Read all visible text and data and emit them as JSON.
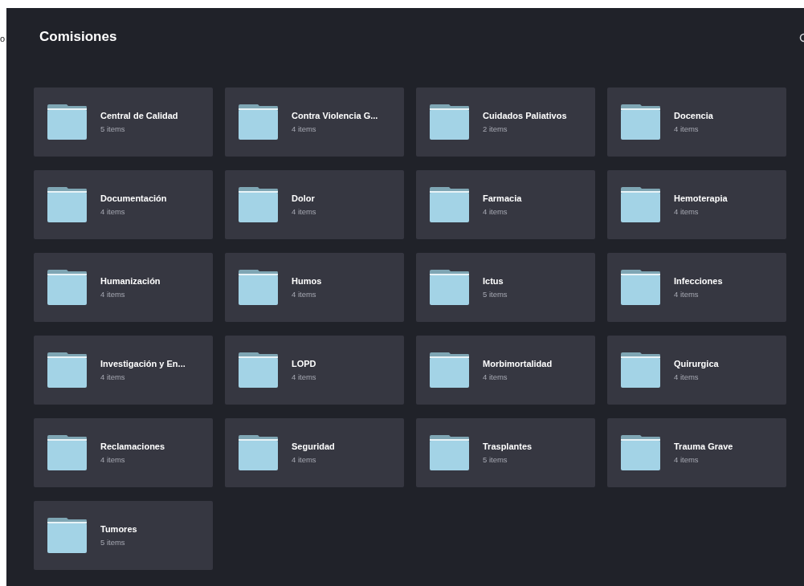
{
  "page_fragment": "o",
  "title": "Comisiones",
  "folders": [
    {
      "name": "Central de Calidad",
      "count": "5 items"
    },
    {
      "name": "Contra Violencia G...",
      "count": "4 items"
    },
    {
      "name": "Cuidados Paliativos",
      "count": "2 items"
    },
    {
      "name": "Docencia",
      "count": "4 items"
    },
    {
      "name": "Documentación",
      "count": "4 items"
    },
    {
      "name": "Dolor",
      "count": "4 items"
    },
    {
      "name": "Farmacia",
      "count": "4 items"
    },
    {
      "name": "Hemoterapia",
      "count": "4 items"
    },
    {
      "name": "Humanización",
      "count": "4 items"
    },
    {
      "name": "Humos",
      "count": "4 items"
    },
    {
      "name": "Ictus",
      "count": "5 items"
    },
    {
      "name": "Infecciones",
      "count": "4 items"
    },
    {
      "name": "Investigación y En...",
      "count": "4 items"
    },
    {
      "name": "LOPD",
      "count": "4 items"
    },
    {
      "name": "Morbimortalidad",
      "count": "4 items"
    },
    {
      "name": "Quirurgica",
      "count": "4 items"
    },
    {
      "name": "Reclamaciones",
      "count": "4 items"
    },
    {
      "name": "Seguridad",
      "count": "4 items"
    },
    {
      "name": "Trasplantes",
      "count": "5 items"
    },
    {
      "name": "Trauma Grave",
      "count": "4 items"
    },
    {
      "name": "Tumores",
      "count": "5 items"
    }
  ]
}
